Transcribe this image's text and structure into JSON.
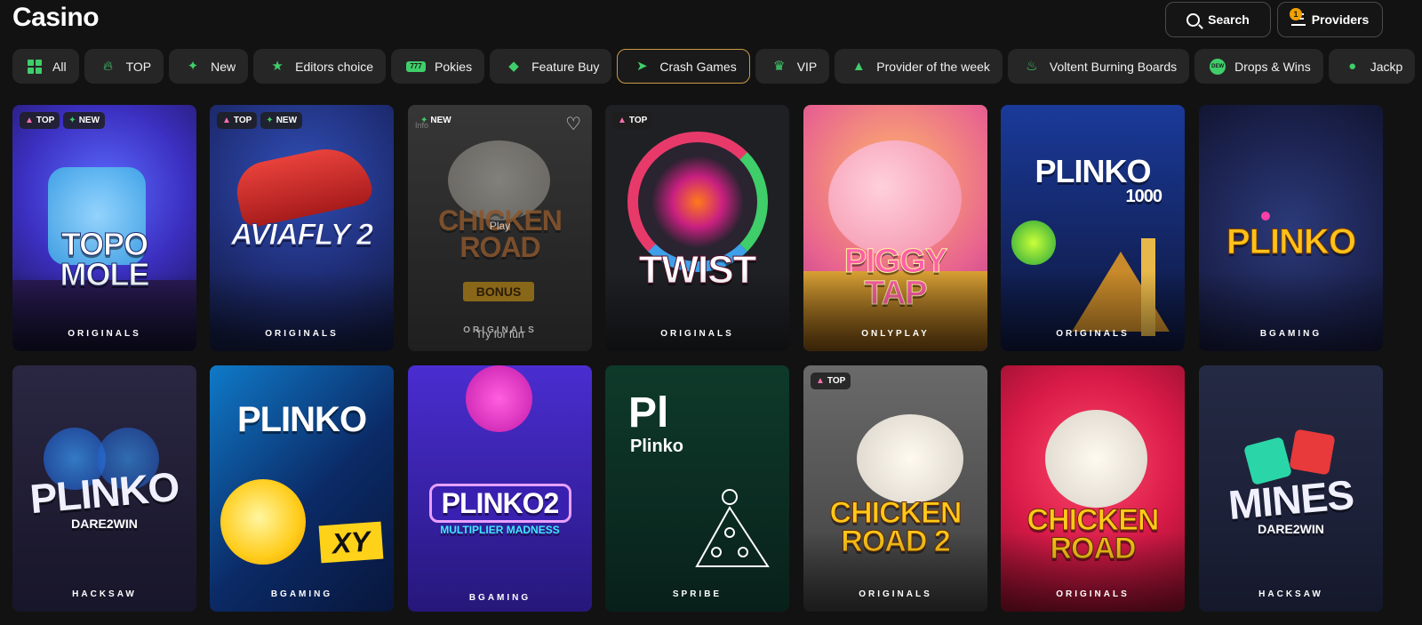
{
  "header": {
    "title": "Casino",
    "search_label": "Search",
    "providers_label": "Providers",
    "providers_badge": "1"
  },
  "categories": [
    {
      "label": "All",
      "icon": "grid-icon"
    },
    {
      "label": "TOP",
      "icon": "flame-icon"
    },
    {
      "label": "New",
      "icon": "sparkle-icon"
    },
    {
      "label": "Editors choice",
      "icon": "star-icon"
    },
    {
      "label": "Pokies",
      "icon": "777-icon"
    },
    {
      "label": "Feature Buy",
      "icon": "tag-icon"
    },
    {
      "label": "Crash Games",
      "icon": "rocket-icon",
      "active": true
    },
    {
      "label": "VIP",
      "icon": "crown-icon"
    },
    {
      "label": "Provider of the week",
      "icon": "thumbs-up-icon"
    },
    {
      "label": "Voltent Burning Boards",
      "icon": "flame-outline-icon"
    },
    {
      "label": "Drops & Wins",
      "icon": "dew-icon"
    },
    {
      "label": "Jackp",
      "icon": "coins-icon"
    }
  ],
  "games_row1": [
    {
      "title": "TOPO\nMOLE",
      "provider": "ORIGINALS",
      "badges": [
        "TOP",
        "NEW"
      ]
    },
    {
      "title": "AVIAFLY 2",
      "provider": "ORIGINALS",
      "badges": [
        "TOP",
        "NEW"
      ]
    },
    {
      "title": "CHICKEN\nROAD",
      "subtitle": "BONUS",
      "provider": "ORIGINALS",
      "badges": [
        "NEW"
      ],
      "hover_play": "Play",
      "hover_try": "Try for fun",
      "hover_top_text": "Info"
    },
    {
      "title": "TWIST",
      "provider": "ORIGINALS",
      "badges": [
        "TOP"
      ]
    },
    {
      "title": "PIGGY\nTAP",
      "provider": "ONLYPLAY",
      "badges": []
    },
    {
      "title": "PLINKO",
      "subtitle": "1000",
      "provider": "ORIGINALS",
      "badges": []
    },
    {
      "title": "PLINKO",
      "provider": "BGAMING",
      "badges": []
    }
  ],
  "games_row2": [
    {
      "title": "PLINKO",
      "subtitle": "DARE2WIN",
      "provider": "HACKSAW",
      "badges": []
    },
    {
      "title": "PLINKO",
      "subtitle": "XY",
      "provider": "BGAMING",
      "badges": []
    },
    {
      "title": "PLINKO2",
      "subtitle": "MULTIPLIER MADNESS",
      "provider": "BGAMING",
      "badges": []
    },
    {
      "title": "Pl",
      "subtitle": "Plinko",
      "provider": "SPRIBE",
      "badges": []
    },
    {
      "title": "CHICKEN\nROAD 2",
      "provider": "ORIGINALS",
      "badges": [
        "TOP"
      ]
    },
    {
      "title": "CHICKEN\nROAD",
      "provider": "ORIGINALS",
      "badges": []
    },
    {
      "title": "MINES",
      "subtitle": "DARE2WIN",
      "provider": "HACKSAW",
      "badges": []
    }
  ],
  "colors": {
    "accent_green": "#3fce6a",
    "active_border": "#c99a45",
    "top_badge_icon": "#ff6fb0",
    "background": "#121212"
  }
}
